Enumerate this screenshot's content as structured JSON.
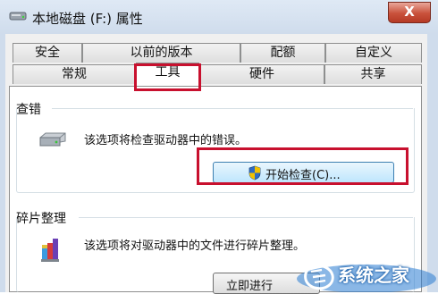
{
  "window": {
    "title": "本地磁盘 (F:) 属性",
    "close_label": "X"
  },
  "tabs": {
    "row_back": [
      "安全",
      "以前的版本",
      "配额",
      "自定义"
    ],
    "row_front": [
      "常规",
      "工具",
      "硬件",
      "共享"
    ],
    "active": "工具"
  },
  "error_check": {
    "title": "查错",
    "description": "该选项将检查驱动器中的错误。",
    "button_label": "开始检查(C)..."
  },
  "defrag": {
    "title": "碎片整理",
    "description": "该选项将对驱动器中的文件进行碎片整理。",
    "button_label": "立即进行"
  },
  "watermark": {
    "text": "系统之家"
  },
  "colors": {
    "highlight": "#c8102e",
    "shield_blue": "#2f6bc2",
    "shield_yellow": "#f2c200"
  },
  "icons": [
    "drive-icon",
    "shield-icon",
    "defrag-icon",
    "close-icon"
  ]
}
